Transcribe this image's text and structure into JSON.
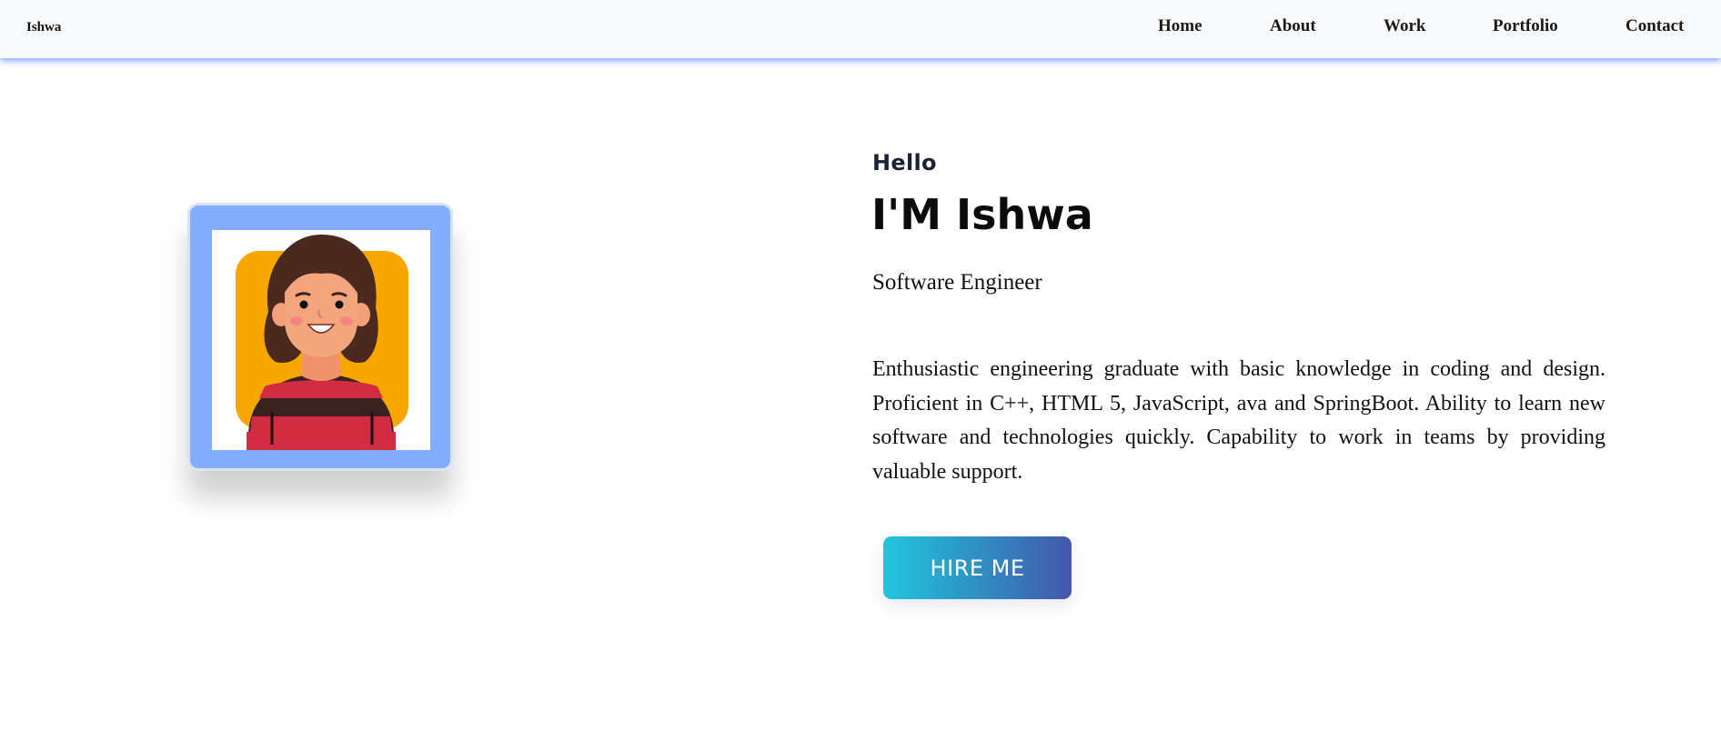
{
  "navbar": {
    "brand": "Ishwa",
    "links": [
      {
        "label": "Home"
      },
      {
        "label": "About"
      },
      {
        "label": "Work"
      },
      {
        "label": "Portfolio"
      },
      {
        "label": "Contact"
      }
    ]
  },
  "avatar": {
    "icon": "person-avatar-illustration"
  },
  "hero": {
    "greeting": "Hello",
    "name": "I'M Ishwa",
    "role": "Software Engineer",
    "bio": "Enthusiastic engineering graduate with basic knowledge in coding and design. Proficient in C++, HTML 5, JavaScript, ava and SpringBoot. Ability to learn new software and technologies quickly. Capability to work in teams by providing valuable support.",
    "cta_label": "HIRE ME"
  },
  "colors": {
    "nav_shadow": "#6e96ff",
    "avatar_frame": "#84adff",
    "avatar_bg": "#f7a700",
    "cta_gradient_start": "#22c6dd",
    "cta_gradient_end": "#4457ab"
  }
}
